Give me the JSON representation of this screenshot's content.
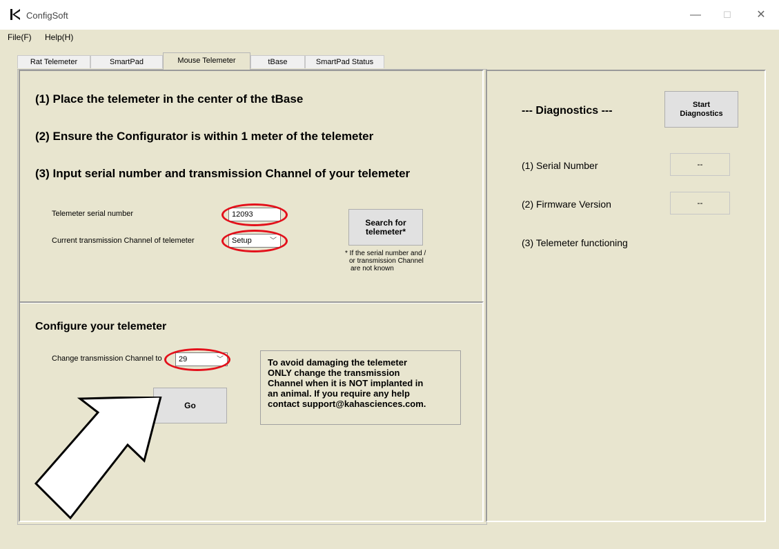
{
  "window": {
    "title": "ConfigSoft",
    "minimize": "—",
    "maximize": "☐",
    "close": "✕"
  },
  "menu": {
    "file": "File(F)",
    "help": "Help(H)"
  },
  "tabs": [
    "Rat Telemeter",
    "SmartPad",
    "Mouse Telemeter",
    "tBase",
    "SmartPad Status"
  ],
  "active_tab": "Mouse Telemeter",
  "instructions": {
    "step1": "(1) Place the telemeter in the center of the tBase",
    "step2": "(2) Ensure the Configurator is within 1 meter of the telemeter",
    "step3": "(3) Input serial number and transmission Channel of your telemeter"
  },
  "serial": {
    "label": "Telemeter serial number",
    "value": "12093"
  },
  "channel": {
    "label": "Current transmission Channel of telemeter",
    "value": "Setup"
  },
  "search": {
    "button": [
      "Search for",
      "telemeter*"
    ],
    "note": [
      "* If the serial number and /",
      "or transmission Channel",
      "are not known"
    ]
  },
  "configure": {
    "heading": "Configure your telemeter",
    "change_label": "Change transmission Channel to",
    "channel_value": "29",
    "go": "Go",
    "warning": [
      "To avoid damaging the telemeter",
      "ONLY change the transmission",
      "Channel when it is NOT implanted in",
      "an animal.  If you require any help",
      "contact support@kahasciences.com."
    ]
  },
  "diagnostics": {
    "title": "--- Diagnostics ---",
    "start_button": [
      "Start",
      "Diagnostics"
    ],
    "serial_label": "(1) Serial Number",
    "serial_value": "--",
    "firmware_label": "(2) Firmware Version",
    "firmware_value": "--",
    "functioning_label": "(3) Telemeter functioning"
  },
  "colors": {
    "annotation_red": "#e3101b",
    "window_bg": "#e8e5cf"
  },
  "icons": [
    "app-logo-icon",
    "chevron-down-icon",
    "annotation-arrow-icon"
  ]
}
